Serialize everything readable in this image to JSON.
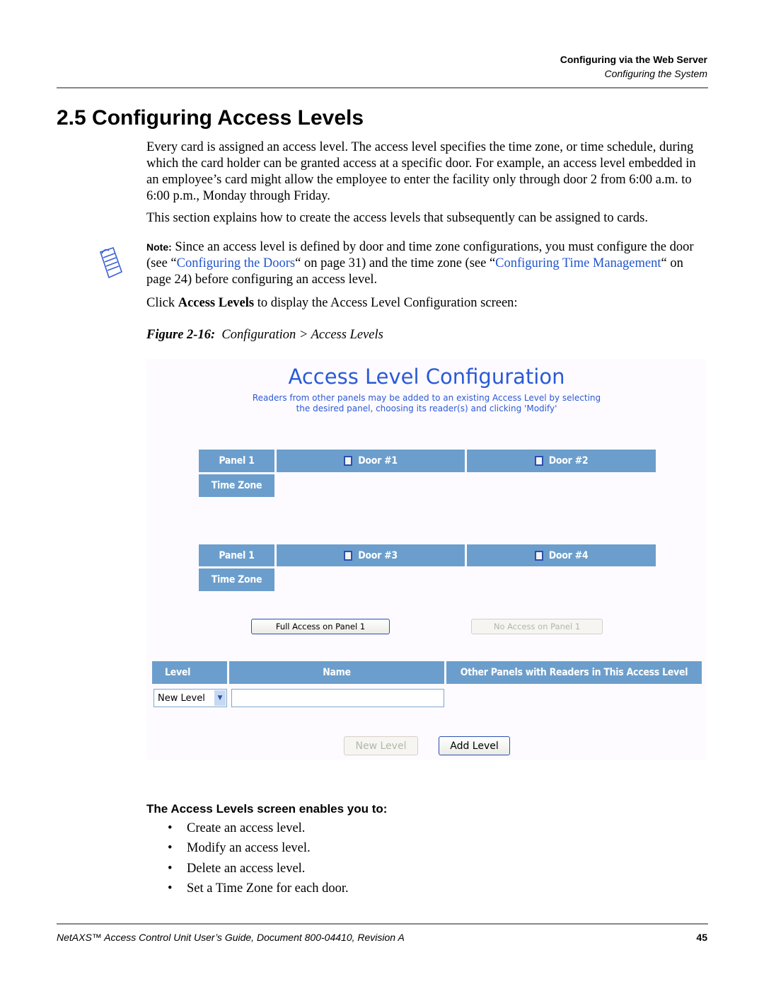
{
  "header": {
    "chapter": "Configuring via the Web Server",
    "section": "Configuring the System"
  },
  "title": "2.5 Configuring Access Levels",
  "paragraphs": {
    "p1": "Every card is assigned an access level. The access level specifies the time zone, or time schedule, during which the card holder can be granted access at a specific door. For example, an access level embedded in an employee’s card might allow the employee to enter the facility only through door 2 from 6:00 a.m. to 6:00 p.m., Monday through Friday.",
    "p2": "This section explains how to create the access levels that subsequently can be assigned to cards."
  },
  "note": {
    "icon": "note-pad-icon",
    "label": "Note:",
    "text_1": " Since an access level is defined by door and time zone configurations, you must configure the door (see “",
    "link_1": "Configuring the Doors",
    "text_2": "“ on page 31) and the time zone (see “",
    "link_2": "Configuring Time Management",
    "text_3": "“ on page 24) before configuring an access level."
  },
  "click_para": {
    "prefix": "Click ",
    "bold": "Access Levels",
    "suffix": " to display the Access Level Configuration screen:"
  },
  "figure": {
    "label": "Figure 2-16:",
    "caption": "Configuration > Access Levels",
    "screen": {
      "title": "Access Level Configuration",
      "subtitle_line1": "Readers from other panels may be added to an existing Access Level by selecting",
      "subtitle_line2": "the desired panel, choosing its reader(s) and clicking 'Modify'",
      "panel_groups": [
        {
          "panel": "Panel 1",
          "time_zone": "Time Zone",
          "doors": [
            {
              "label": "Door #1",
              "checked": false
            },
            {
              "label": "Door #2",
              "checked": false
            }
          ]
        },
        {
          "panel": "Panel 1",
          "time_zone": "Time Zone",
          "doors": [
            {
              "label": "Door #3",
              "checked": false
            },
            {
              "label": "Door #4",
              "checked": false
            }
          ]
        }
      ],
      "full_access_button": "Full Access on Panel 1",
      "no_access_button": "No Access on Panel 1",
      "table_headers": [
        "Level",
        "Name",
        "Other Panels with Readers in This Access Level"
      ],
      "level_select_value": "New Level",
      "name_input_value": "",
      "new_level_button": "New Level",
      "add_level_button": "Add Level"
    }
  },
  "enables": {
    "heading": "The Access Levels screen enables you to:",
    "items": [
      "Create an access level.",
      "Modify an access level.",
      "Delete an access level.",
      "Set a Time Zone for each door."
    ]
  },
  "footer": {
    "doc": "NetAXS™ Access Control Unit User’s Guide, Document 800-04410, Revision A",
    "page": "45"
  }
}
